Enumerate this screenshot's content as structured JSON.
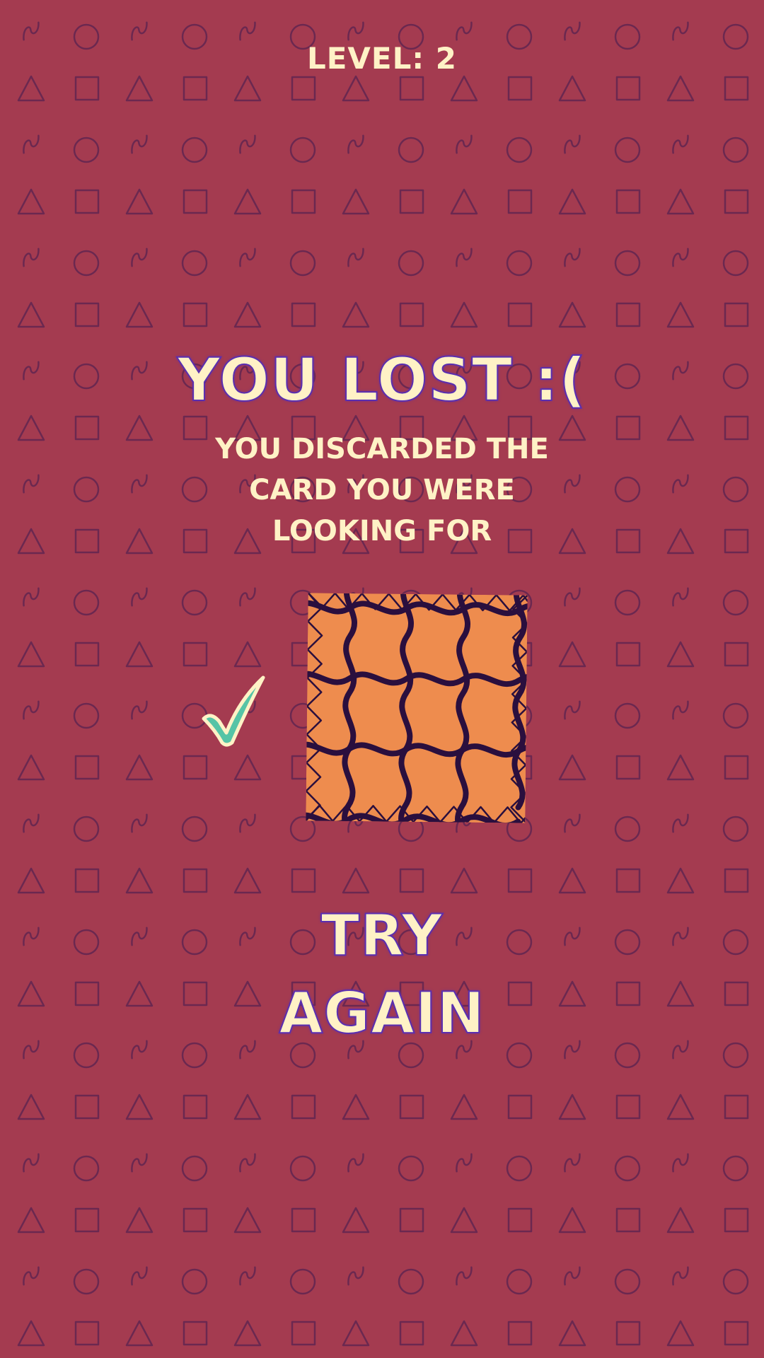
{
  "level": {
    "label": "LEVEL: 2"
  },
  "result": {
    "title": "YOU LOST :(",
    "message": "YOU DISCARDED THE CARD YOU WERE LOOKING FOR"
  },
  "target_card": {
    "pattern": "wavy-lines-zigzag",
    "fill_color": "#ee8c4e",
    "line_color": "#2a0f3e",
    "marked_correct": true
  },
  "actions": {
    "try_again_label": "TRY AGAIN"
  },
  "colors": {
    "background": "#a43b50",
    "background_shapes": "#6b2850",
    "text": "#fff2c6",
    "text_outline": "#5a2fb0",
    "check": "#56c4a6",
    "check_outline": "#fff2c6"
  },
  "background_shapes": [
    "wave",
    "circle",
    "triangle",
    "square"
  ]
}
